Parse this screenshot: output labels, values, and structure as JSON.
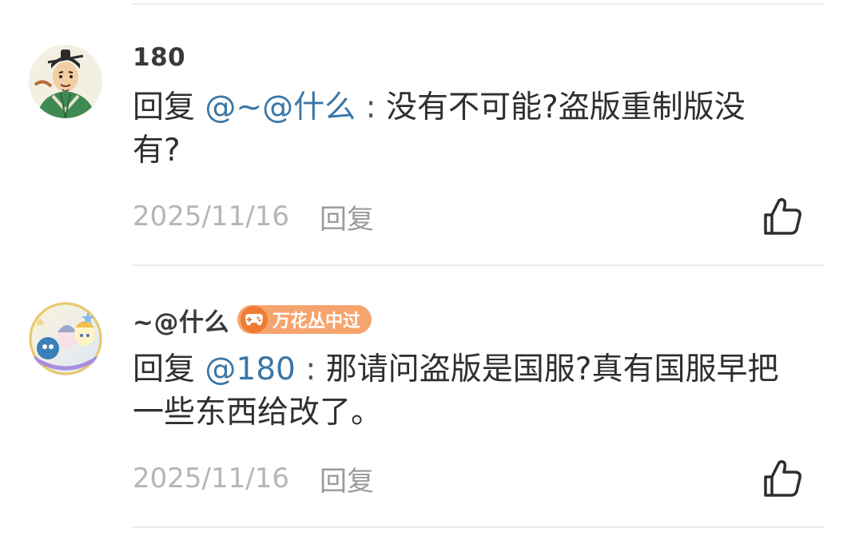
{
  "comments": [
    {
      "username": "180",
      "reply_prefix": "回复 ",
      "mention": "@~@什么",
      "separator": " : ",
      "text_line1": "没有不可能?盗版重制版没",
      "text_line2": "有?",
      "date": "2025/11/16",
      "reply_label": "回复",
      "like_icon": "thumbs-up-icon",
      "avatar_icon": "avatar-ancient-scholar"
    },
    {
      "username": "~@什么",
      "badge": {
        "label": "万花丛中过",
        "icon": "gamepad-icon",
        "color": "#f6a46e"
      },
      "reply_prefix": "回复 ",
      "mention": "@180",
      "separator": " : ",
      "text_line1": "那请问盗版是国服?真有国服早把",
      "text_line2": "一些东西给改了。",
      "date": "2025/11/16",
      "reply_label": "回复",
      "like_icon": "thumbs-up-icon",
      "avatar_icon": "avatar-anime-characters"
    }
  ],
  "colors": {
    "mention": "#3a76a6",
    "date": "#b5b5b5",
    "divider": "#ececec"
  }
}
